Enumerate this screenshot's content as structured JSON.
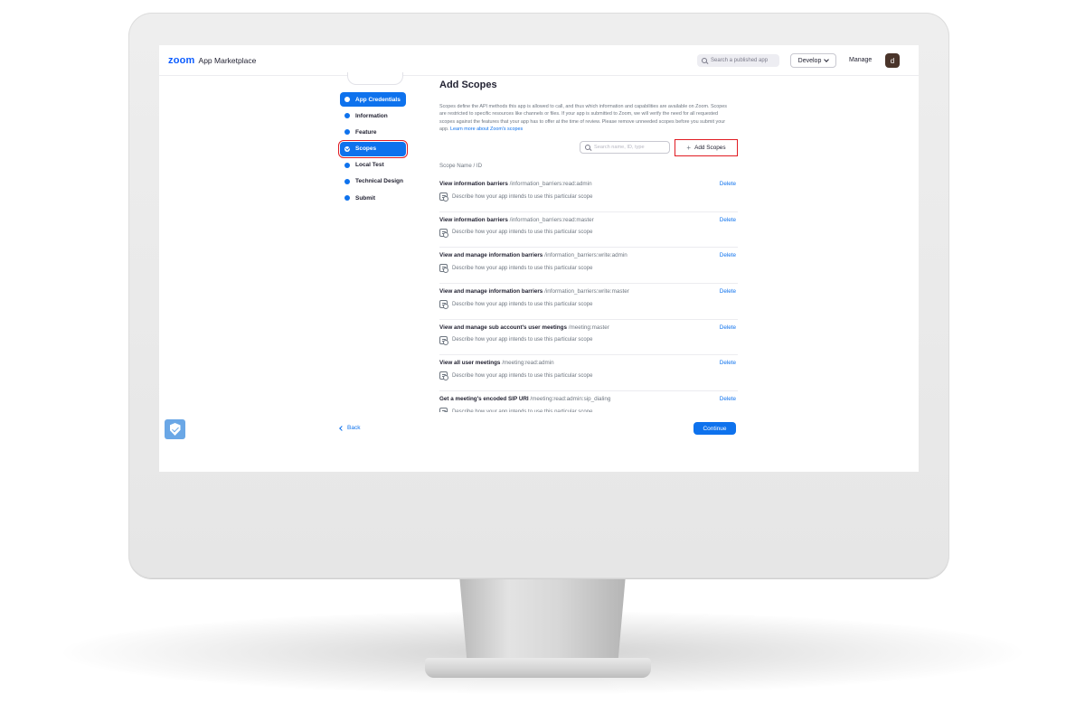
{
  "header": {
    "logo_brand": "zoom",
    "logo_text": "App Marketplace",
    "search_placeholder": "Search a published app",
    "develop_label": "Develop",
    "manage_label": "Manage",
    "avatar_initial": "d"
  },
  "nav": {
    "items": [
      {
        "label": "App Credentials",
        "state": "active"
      },
      {
        "label": "Information",
        "state": "default"
      },
      {
        "label": "Feature",
        "state": "default"
      },
      {
        "label": "Scopes",
        "state": "active-highlighted"
      },
      {
        "label": "Local Test",
        "state": "default"
      },
      {
        "label": "Technical Design",
        "state": "default"
      },
      {
        "label": "Submit",
        "state": "default"
      }
    ]
  },
  "main": {
    "title": "Add Scopes",
    "description": "Scopes define the API methods this app is allowed to call, and thus which information and capabilities are available on Zoom. Scopes are restricted to specific resources like channels or files. If your app is submitted to Zoom, we will verify the need for all requested scopes against the features that your app has to offer at the time of review. Please remove unneeded scopes before you submit your app.",
    "learn_more": "Learn more about Zoom's scopes",
    "search_placeholder": "Search name, ID, type",
    "add_scopes_label": "Add Scopes",
    "column_header": "Scope Name / ID",
    "delete_label": "Delete",
    "row_hint": "Describe how your app intends to use this particular scope",
    "scopes": [
      {
        "name": "View information barriers",
        "id": "/information_barriers:read:admin"
      },
      {
        "name": "View information barriers",
        "id": "/information_barriers:read:master"
      },
      {
        "name": "View and manage information barriers",
        "id": "/information_barriers:write:admin"
      },
      {
        "name": "View and manage information barriers",
        "id": "/information_barriers:write:master"
      },
      {
        "name": "View and manage sub account's user meetings",
        "id": "/meeting:master"
      },
      {
        "name": "View all user meetings",
        "id": "/meeting:read:admin"
      },
      {
        "name": "Get a meeting's encoded SIP URI",
        "id": "/meeting:read:admin:sip_dialing"
      }
    ]
  },
  "footer": {
    "back_label": "Back",
    "continue_label": "Continue"
  },
  "colors": {
    "accent": "#0e72ed",
    "brand": "#0b5cff",
    "highlight": "#e11b22"
  },
  "icons": {
    "badge": "shield-check-icon"
  }
}
